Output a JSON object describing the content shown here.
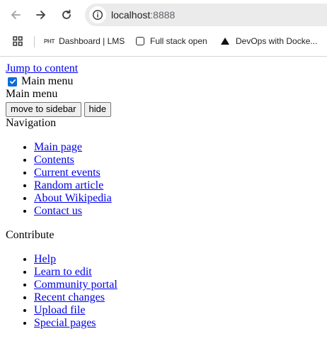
{
  "browser": {
    "url_host": "localhost",
    "url_port": ":8888",
    "bookmarks": [
      {
        "prefix": "PHT",
        "label": "Dashboard | LMS"
      },
      {
        "label": "Full stack open"
      },
      {
        "label": "DevOps with Docke..."
      }
    ]
  },
  "page": {
    "skip_link": "Jump to content",
    "main_menu_checkbox_label": "Main menu",
    "main_menu_heading": "Main menu",
    "move_button": "move to sidebar",
    "hide_button": "hide",
    "navigation_heading": "Navigation",
    "navigation_links": [
      "Main page",
      "Contents",
      "Current events",
      "Random article",
      "About Wikipedia",
      "Contact us"
    ],
    "contribute_heading": "Contribute",
    "contribute_links": [
      "Help",
      "Learn to edit",
      "Community portal",
      "Recent changes",
      "Upload file",
      "Special pages"
    ]
  }
}
